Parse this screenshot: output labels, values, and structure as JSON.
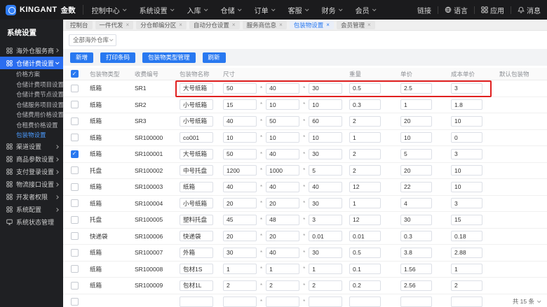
{
  "topbar": {
    "brand_name": "KINGANT",
    "brand_suffix": "金数",
    "menus": [
      "控制中心",
      "系统设置",
      "入库",
      "仓储",
      "订单",
      "客服",
      "财务",
      "会员"
    ],
    "right_items": [
      {
        "label": "链接",
        "icon": ""
      },
      {
        "label": "语言",
        "icon": "globe-icon"
      },
      {
        "label": "应用",
        "icon": "grid-icon"
      },
      {
        "label": "消息",
        "icon": "bell-icon"
      }
    ]
  },
  "sidebar": {
    "title": "系统设置",
    "items": [
      {
        "label": "海外仓服务商",
        "level": "parent",
        "icon": "grid-icon",
        "chevron": "right"
      },
      {
        "label": "仓储计费设置",
        "level": "parent",
        "icon": "grid-icon",
        "chevron": "down",
        "active": true
      },
      {
        "label": "价格方案",
        "level": "sub"
      },
      {
        "label": "仓储计费项目设置",
        "level": "sub"
      },
      {
        "label": "仓储计费节点设置",
        "level": "sub"
      },
      {
        "label": "仓储服务项目设置",
        "level": "sub"
      },
      {
        "label": "仓储费用价格设置",
        "level": "sub"
      },
      {
        "label": "仓租费价格设置",
        "level": "sub"
      },
      {
        "label": "包装物设置",
        "level": "sub",
        "current": true
      },
      {
        "label": "渠道设置",
        "level": "parent",
        "icon": "grid-icon",
        "chevron": "right"
      },
      {
        "label": "商品参数设置",
        "level": "parent",
        "icon": "grid-icon",
        "chevron": "right"
      },
      {
        "label": "支付登录设置",
        "level": "parent",
        "icon": "grid-icon",
        "chevron": "right"
      },
      {
        "label": "物流接口设置",
        "level": "parent",
        "icon": "grid-icon",
        "chevron": "right"
      },
      {
        "label": "开发者权限",
        "level": "parent",
        "icon": "grid-icon",
        "chevron": "right"
      },
      {
        "label": "系统配置",
        "level": "parent",
        "icon": "grid-icon",
        "chevron": "right"
      },
      {
        "label": "系统状态管理",
        "level": "parent",
        "icon": "monitor-icon",
        "chevron": ""
      }
    ]
  },
  "tabs": [
    {
      "label": "控制台",
      "closable": false,
      "active": false
    },
    {
      "label": "一件代发",
      "closable": true,
      "active": false
    },
    {
      "label": "分仓邮编分区",
      "closable": true,
      "active": false
    },
    {
      "label": "自动分仓设置",
      "closable": true,
      "active": false
    },
    {
      "label": "服务商信息",
      "closable": true,
      "active": false
    },
    {
      "label": "包装物设置",
      "closable": true,
      "active": true
    },
    {
      "label": "会员管理",
      "closable": true,
      "active": false
    }
  ],
  "filter": {
    "warehouse_select": "全部海外仓库"
  },
  "toolbar": {
    "buttons": [
      "新增",
      "打印条码",
      "包装物类型管理",
      "刷新"
    ]
  },
  "table": {
    "columns": [
      "包装物类型",
      "收费编号",
      "包装物名称",
      "尺寸",
      "重量",
      "单价",
      "成本单价",
      "默认包装物"
    ],
    "header_checkbox_checked": true,
    "rows": [
      {
        "type": "纸箱",
        "code": "SR1",
        "name": "大号纸箱",
        "dims": [
          "50",
          "40",
          "30"
        ],
        "weight": "0.5",
        "price": "2.5",
        "cost": "3",
        "checked": false,
        "default_on": false,
        "highlighted": true
      },
      {
        "type": "纸箱",
        "code": "SR2",
        "name": "小号纸箱",
        "dims": [
          "15",
          "10",
          "10"
        ],
        "weight": "0.3",
        "price": "1",
        "cost": "1.8",
        "checked": false,
        "default_on": true
      },
      {
        "type": "纸箱",
        "code": "SR3",
        "name": "小号纸箱",
        "dims": [
          "40",
          "50",
          "60"
        ],
        "weight": "2",
        "price": "20",
        "cost": "10",
        "checked": false,
        "default_on": false
      },
      {
        "type": "纸箱",
        "code": "SR100000",
        "name": "co001",
        "dims": [
          "10",
          "10",
          "10"
        ],
        "weight": "1",
        "price": "10",
        "cost": "0",
        "checked": false,
        "default_on": false
      },
      {
        "type": "纸箱",
        "code": "SR100001",
        "name": "大号纸箱",
        "dims": [
          "50",
          "40",
          "30"
        ],
        "weight": "2",
        "price": "5",
        "cost": "3",
        "checked": true,
        "default_on": false
      },
      {
        "type": "托盘",
        "code": "SR100002",
        "name": "中号托盘",
        "dims": [
          "1200",
          "1000",
          "5"
        ],
        "weight": "2",
        "price": "20",
        "cost": "10",
        "checked": false,
        "default_on": false
      },
      {
        "type": "纸箱",
        "code": "SR100003",
        "name": "纸箱",
        "dims": [
          "40",
          "40",
          "40"
        ],
        "weight": "12",
        "price": "22",
        "cost": "10",
        "checked": false,
        "default_on": false
      },
      {
        "type": "纸箱",
        "code": "SR100004",
        "name": "小号纸箱",
        "dims": [
          "20",
          "20",
          "30"
        ],
        "weight": "1",
        "price": "4",
        "cost": "3",
        "checked": false,
        "default_on": false
      },
      {
        "type": "托盘",
        "code": "SR100005",
        "name": "塑料托盘",
        "dims": [
          "45",
          "48",
          "3"
        ],
        "weight": "12",
        "price": "30",
        "cost": "15",
        "checked": false,
        "default_on": false
      },
      {
        "type": "快递袋",
        "code": "SR100006",
        "name": "快递袋",
        "dims": [
          "20",
          "20",
          "0.01"
        ],
        "weight": "0.01",
        "price": "0.3",
        "cost": "0.18",
        "checked": false,
        "default_on": true
      },
      {
        "type": "纸箱",
        "code": "SR100007",
        "name": "外箱",
        "dims": [
          "30",
          "40",
          "30"
        ],
        "weight": "0.5",
        "price": "3.8",
        "cost": "2.88",
        "checked": false,
        "default_on": false
      },
      {
        "type": "纸箱",
        "code": "SR100008",
        "name": "包材1S",
        "dims": [
          "1",
          "1",
          "1"
        ],
        "weight": "0.1",
        "price": "1.56",
        "cost": "1",
        "checked": false,
        "default_on": false
      },
      {
        "type": "纸箱",
        "code": "SR100009",
        "name": "包材1L",
        "dims": [
          "2",
          "2",
          "2"
        ],
        "weight": "0.2",
        "price": "2.56",
        "cost": "2",
        "checked": false,
        "default_on": false
      },
      {
        "type": "",
        "code": "",
        "name": "",
        "dims": [
          "",
          "",
          ""
        ],
        "weight": "",
        "price": "",
        "cost": "",
        "checked": false,
        "default_on": false,
        "partial": true
      }
    ]
  },
  "pagination": {
    "total_label": "共 15 条"
  },
  "colors": {
    "accent": "#2878f0",
    "topbar_bg": "#1b1b1d",
    "sidebar_bg": "#1f2023",
    "sidebar_active_bg": "#2a6df0",
    "active_link": "#4b9bff",
    "highlight_red": "#e02020",
    "toggle_off": "#dcdfe6"
  }
}
